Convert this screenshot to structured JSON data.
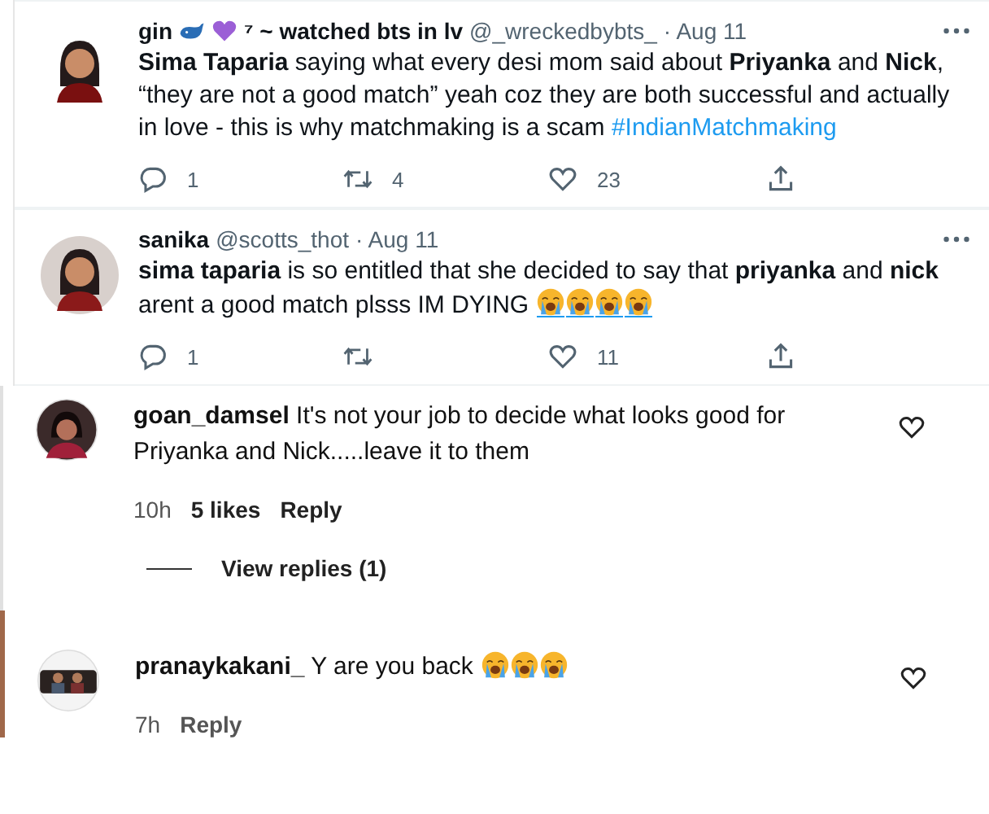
{
  "tweets": [
    {
      "name": "gin",
      "name_emojis": [
        {
          "kind": "whale"
        },
        {
          "kind": "heart"
        }
      ],
      "name_suffix": "⁷ ~ watched bts in lv",
      "handle": "@_wreckedbybts_",
      "date": "· Aug 11",
      "text": "**Sima Taparia** saying what every desi mom said about **Priyanka** and **Nick**, “they are not a good match” yeah coz they are both successful and actually in love - this is why matchmaking is a scam",
      "hashtag": "#IndianMatchmaking",
      "replies": "1",
      "retweets": "4",
      "likes": "23"
    },
    {
      "name": "sanika",
      "handle": "@scotts_thot",
      "date": "· Aug 11",
      "text": "**sima taparia** is so entitled that she decided to say that **priyanka** and **nick** arent a good match plsss IM DYING",
      "text_emojis": [
        {
          "kind": "crying"
        },
        {
          "kind": "crying"
        },
        {
          "kind": "crying"
        },
        {
          "kind": "crying"
        }
      ],
      "replies": "1",
      "likes": "11"
    }
  ],
  "comments": [
    {
      "user": "goan_damsel",
      "text": "It's not your job to decide what looks good for Priyanka and Nick.....leave it to them",
      "time": "10h",
      "likes": "5 likes",
      "reply": "Reply",
      "view_replies": "View replies (1)"
    },
    {
      "user": "pranaykakani_",
      "text": "Y are you back",
      "text_emojis": [
        {
          "kind": "crying"
        },
        {
          "kind": "crying"
        },
        {
          "kind": "crying"
        }
      ],
      "time": "7h",
      "reply": "Reply"
    }
  ]
}
